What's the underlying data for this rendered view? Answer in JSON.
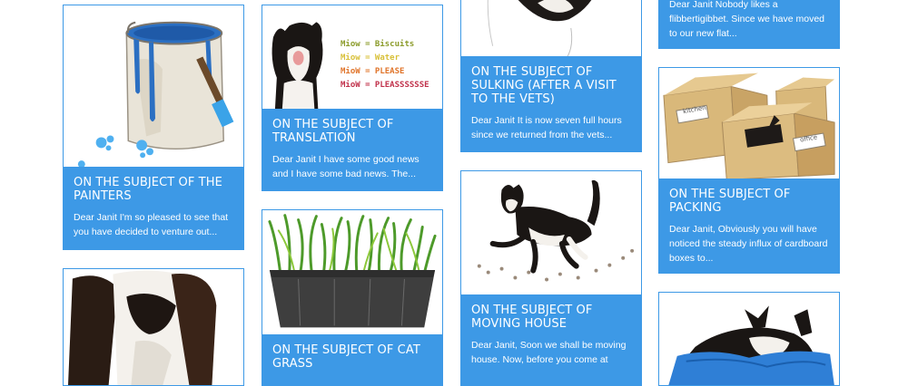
{
  "posts": [
    {
      "title": "ON THE SUBJECT OF THE PAINTERS",
      "excerpt": "Dear Janit I'm so pleased to see that you have decided to venture out..."
    },
    {
      "title": "ON THE SUBJECT OF TRANSLATION",
      "excerpt": "Dear Janit I have some good news and I have some bad news. The..."
    },
    {
      "title": "ON THE SUBJECT OF CAT GRASS",
      "excerpt": ""
    },
    {
      "title": "ON THE SUBJECT OF SULKING (AFTER A VISIT TO THE VETS)",
      "excerpt": "Dear Janit It is now seven full hours since we returned from the vets..."
    },
    {
      "title": "ON THE SUBJECT OF MOVING HOUSE",
      "excerpt": "Dear Janit, Soon we shall be moving house. Now, before you come at"
    },
    {
      "excerpt": "Dear Janit Nobody likes a flibbertigibbet. Since we have moved to our new flat..."
    },
    {
      "title": "ON THE SUBJECT OF PACKING",
      "excerpt": "Dear Janit, Obviously you will have noticed the steady influx of cardboard boxes to..."
    }
  ],
  "translation_image_text": [
    "Miow = Biscuits",
    "Miow = Water",
    "MioW = PLEASE",
    "MioW = PLEASSSSSSE"
  ],
  "box_labels": [
    "kitchen",
    "office"
  ]
}
